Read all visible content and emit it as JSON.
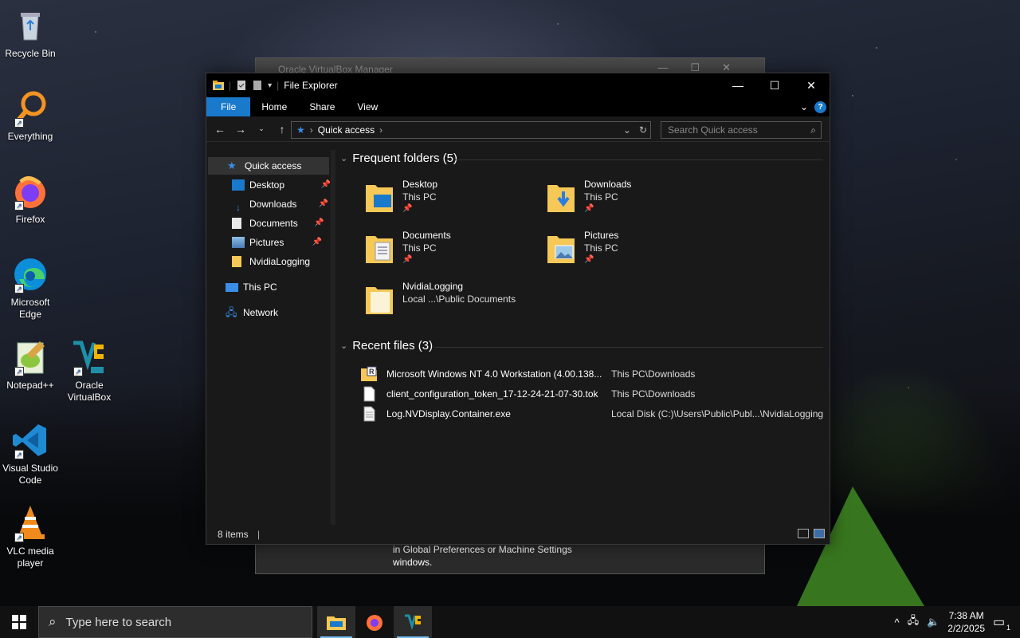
{
  "desktop": {
    "icons": [
      {
        "label": "Recycle Bin",
        "icon": "recycle-bin-icon"
      },
      {
        "label": "Everything",
        "icon": "everything-search-icon"
      },
      {
        "label": "Firefox",
        "icon": "firefox-icon"
      },
      {
        "label": "Microsoft Edge",
        "icon": "edge-icon"
      },
      {
        "label": "Notepad++",
        "icon": "notepadpp-icon"
      },
      {
        "label": "Oracle VirtualBox",
        "icon": "virtualbox-icon"
      },
      {
        "label": "Visual Studio Code",
        "icon": "vscode-icon"
      },
      {
        "label": "VLC media player",
        "icon": "vlc-icon"
      }
    ]
  },
  "background_window": {
    "title": "Oracle VirtualBox Manager",
    "text_line1": "in Global Preferences or Machine Settings",
    "text_line2": "windows."
  },
  "explorer": {
    "title": "File Explorer",
    "ribbon_tabs": [
      "File",
      "Home",
      "Share",
      "View"
    ],
    "address": "Quick access",
    "search_placeholder": "Search Quick access",
    "nav": {
      "quick_access": "Quick access",
      "pinned": [
        {
          "label": "Desktop",
          "pinned": true
        },
        {
          "label": "Downloads",
          "pinned": true
        },
        {
          "label": "Documents",
          "pinned": true
        },
        {
          "label": "Pictures",
          "pinned": true
        },
        {
          "label": "NvidiaLogging",
          "pinned": false
        }
      ],
      "this_pc": "This PC",
      "network": "Network"
    },
    "frequent_header": "Frequent folders (5)",
    "frequent": [
      {
        "name": "Desktop",
        "location": "This PC",
        "pinned": true
      },
      {
        "name": "Downloads",
        "location": "This PC",
        "pinned": true
      },
      {
        "name": "Documents",
        "location": "This PC",
        "pinned": true
      },
      {
        "name": "Pictures",
        "location": "This PC",
        "pinned": true
      },
      {
        "name": "NvidiaLogging",
        "location": "Local ...\\Public Documents",
        "pinned": false
      }
    ],
    "recent_header": "Recent files (3)",
    "recent": [
      {
        "name": "Microsoft Windows NT 4.0 Workstation (4.00.138...",
        "location": "This PC\\Downloads"
      },
      {
        "name": "client_configuration_token_17-12-24-21-07-30.tok",
        "location": "This PC\\Downloads"
      },
      {
        "name": "Log.NVDisplay.Container.exe",
        "location": "Local Disk (C:)\\Users\\Public\\Publ...\\NvidiaLogging"
      }
    ],
    "status": "8 items"
  },
  "taskbar": {
    "search_placeholder": "Type here to search",
    "time": "7:38 AM",
    "date": "2/2/2025",
    "notifications": "1"
  },
  "colors": {
    "accent": "#1979ca",
    "folder": "#f5c857",
    "tent": "#3f8a22"
  }
}
